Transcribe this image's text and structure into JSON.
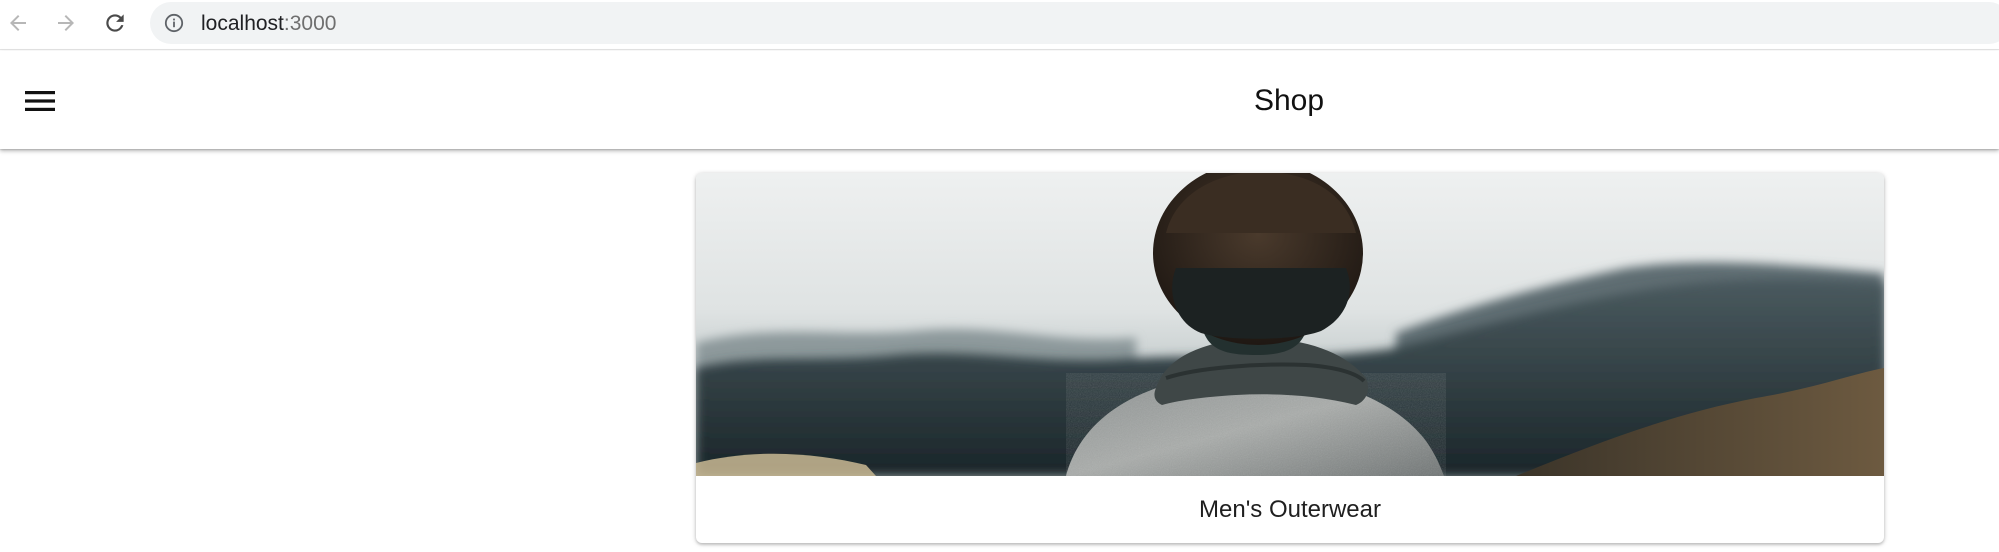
{
  "browser": {
    "url_host": "localhost",
    "url_port": ":3000",
    "icons": {
      "back": "arrow-back-icon",
      "forward": "arrow-forward-icon",
      "reload": "reload-icon",
      "site_info": "info-icon"
    }
  },
  "app_bar": {
    "title": "Shop",
    "menu_icon": "hamburger-menu-icon"
  },
  "category_card": {
    "label": "Men's Outerwear",
    "image": "photo of a person in a grey sweater and scarf facing a misty forested hillside"
  },
  "colors": {
    "page_background": "#ffffff",
    "url_bar_background": "#f1f3f4",
    "title_text": "#111111"
  }
}
